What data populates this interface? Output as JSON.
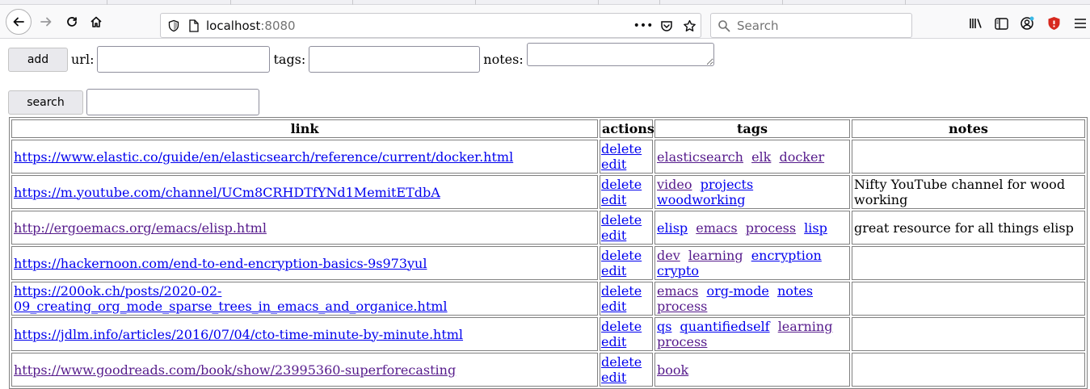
{
  "browser": {
    "url_host": "localhost",
    "url_port": ":8080",
    "search_placeholder": "Search"
  },
  "add_form": {
    "add_label": "add",
    "url_label": "url:",
    "tags_label": "tags:",
    "notes_label": "notes:",
    "url_value": "",
    "tags_value": "",
    "notes_value": ""
  },
  "search_form": {
    "search_label": "search",
    "search_value": ""
  },
  "table": {
    "headers": [
      "link",
      "actions",
      "tags",
      "notes"
    ],
    "delete_label": "delete",
    "edit_label": "edit",
    "rows": [
      {
        "link": "https://www.elastic.co/guide/en/elasticsearch/reference/current/docker.html",
        "link_visited": false,
        "tags": [
          {
            "text": "elasticsearch",
            "visited": true
          },
          {
            "text": "elk",
            "visited": true
          },
          {
            "text": "docker",
            "visited": true
          }
        ],
        "notes": ""
      },
      {
        "link": "https://m.youtube.com/channel/UCm8CRHDTfYNd1MemitETdbA",
        "link_visited": false,
        "tags": [
          {
            "text": "video",
            "visited": true
          },
          {
            "text": "projects",
            "visited": false
          },
          {
            "text": "woodworking",
            "visited": false
          }
        ],
        "notes": "Nifty YouTube channel for wood working"
      },
      {
        "link": "http://ergoemacs.org/emacs/elisp.html",
        "link_visited": true,
        "tags": [
          {
            "text": "elisp",
            "visited": false
          },
          {
            "text": "emacs",
            "visited": true
          },
          {
            "text": "process",
            "visited": true
          },
          {
            "text": "lisp",
            "visited": false
          }
        ],
        "notes": "great resource for all things elisp"
      },
      {
        "link": "https://hackernoon.com/end-to-end-encryption-basics-9s973yul",
        "link_visited": false,
        "tags": [
          {
            "text": "dev",
            "visited": true
          },
          {
            "text": "learning",
            "visited": true
          },
          {
            "text": "encryption",
            "visited": false
          },
          {
            "text": "crypto",
            "visited": false
          }
        ],
        "notes": ""
      },
      {
        "link": "https://200ok.ch/posts/2020-02-09_creating_org_mode_sparse_trees_in_emacs_and_organice.html",
        "link_visited": false,
        "tags": [
          {
            "text": "emacs",
            "visited": true
          },
          {
            "text": "org-mode",
            "visited": false
          },
          {
            "text": "notes",
            "visited": false
          },
          {
            "text": "process",
            "visited": true
          }
        ],
        "notes": ""
      },
      {
        "link": "https://jdlm.info/articles/2016/07/04/cto-time-minute-by-minute.html",
        "link_visited": false,
        "tags": [
          {
            "text": "qs",
            "visited": false
          },
          {
            "text": "quantifiedself",
            "visited": false
          },
          {
            "text": "learning",
            "visited": true
          },
          {
            "text": "process",
            "visited": true
          }
        ],
        "notes": ""
      },
      {
        "link": "https://www.goodreads.com/book/show/23995360-superforecasting",
        "link_visited": true,
        "tags": [
          {
            "text": "book",
            "visited": true
          }
        ],
        "notes": ""
      }
    ]
  }
}
